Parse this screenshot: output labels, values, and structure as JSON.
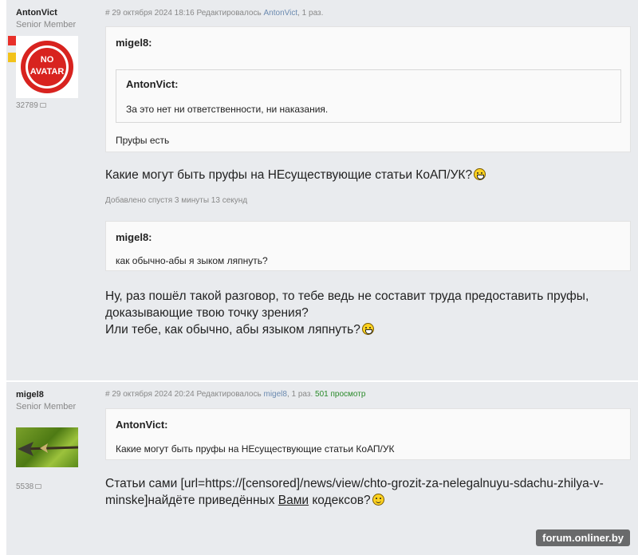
{
  "post1": {
    "author": {
      "name": "AntonVict",
      "rank": "Senior Member",
      "msg_count": "32789"
    },
    "meta": {
      "prefix": "# 29 октября 2024 18:16 Редактировалось ",
      "editor": "AntonVict",
      "suffix": ", 1 раз."
    },
    "quote": {
      "author": "migel8:",
      "inner_quote": {
        "author": "AntonVict:",
        "text": "За это нет ни ответственности, ни наказания."
      },
      "text": "Пруфы есть"
    },
    "text1": "Какие могут быть пруфы на НЕсуществующие статьи КоАП/УК?",
    "added_note": "Добавлено спустя 3 минуты 13 секунд",
    "quote2": {
      "author": "migel8:",
      "text": "как обычно-абы я зыком ляпнуть?"
    },
    "text2_line1": "Ну, раз пошёл такой разговор, то тебе ведь не составит труда предоставить пруфы,",
    "text2_line2": "доказывающие твою точку зрения?",
    "text2_line3": "Или тебе, как обычно, абы языком ляпнуть?"
  },
  "post2": {
    "author": {
      "name": "migel8",
      "rank": "Senior Member",
      "msg_count": "5538"
    },
    "meta": {
      "prefix": "# 29 октября 2024 20:24 Редактировалось ",
      "editor": "migel8",
      "suffix": ", 1 раз. ",
      "views": "501 просмотр"
    },
    "quote": {
      "author": "AntonVict:",
      "text": "Какие могут быть пруфы на НЕсуществующие статьи КоАП/УК"
    },
    "text_line1": "Статьи сами [url=https://[censored]/news/view/chto-grozit-za-nelegalnuyu-sdachu-zhilya-v-",
    "text_line2_a": "minske]найдёте приведённых ",
    "text_line2_link": "Вами",
    "text_line2_b": " кодексов?"
  },
  "avatar1": {
    "label_line1": "NO",
    "label_line2": "AVATAR"
  },
  "icons": {
    "smiley_laugh": "laughing-smiley-icon",
    "smiley_smile": "smile-smiley-icon",
    "comment": "comment-bubble-icon"
  },
  "colors": {
    "post_bg": "#e9ebee",
    "quote_bg": "#fafafa",
    "link": "#6b8ab0",
    "views": "#2a8a2a",
    "ribbon_red": "#e8302a",
    "ribbon_yellow": "#f2c21a"
  },
  "watermark": "forum.onliner.by"
}
